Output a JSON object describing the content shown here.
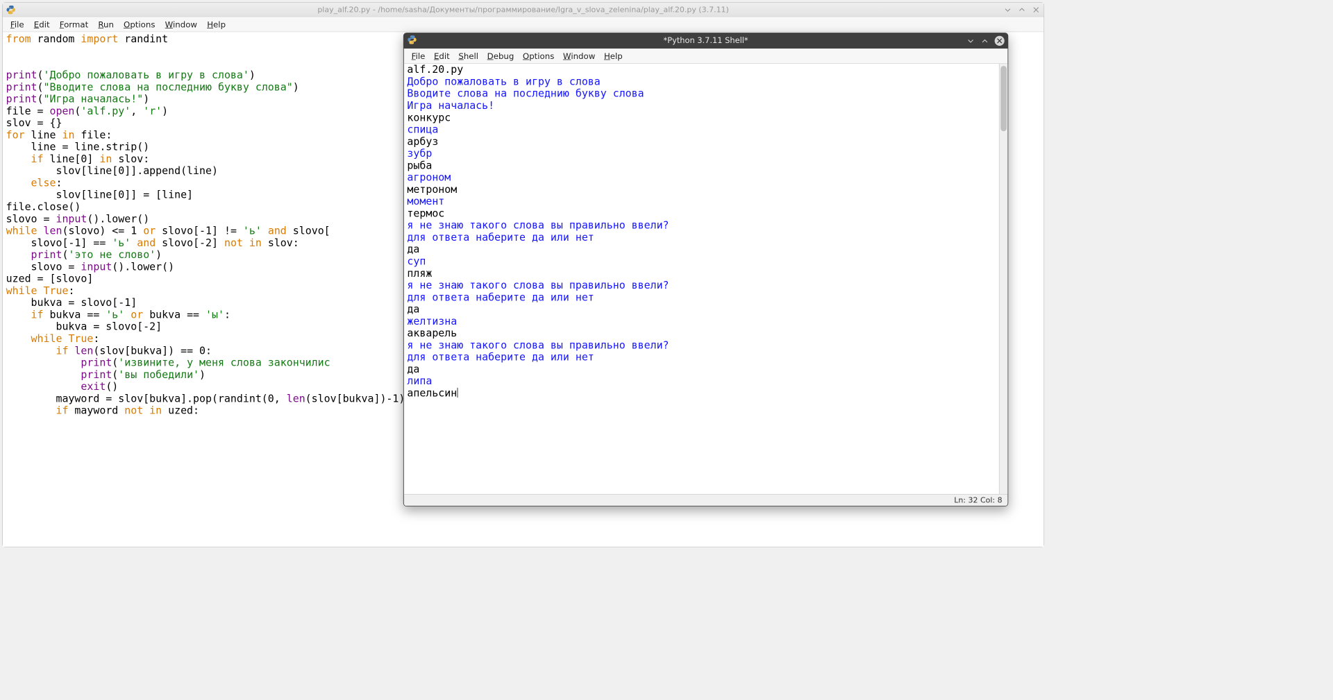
{
  "editor": {
    "title": "play_alf.20.py - /home/sasha/Документы/программирование/Igra_v_slova_zelenina/play_alf.20.py (3.7.11)",
    "menu": [
      "File",
      "Edit",
      "Format",
      "Run",
      "Options",
      "Window",
      "Help"
    ],
    "code_tokens": [
      [
        {
          "t": "from ",
          "c": "kw"
        },
        {
          "t": "random ",
          "c": ""
        },
        {
          "t": "import ",
          "c": "kw"
        },
        {
          "t": "randint",
          "c": ""
        }
      ],
      [],
      [],
      [
        {
          "t": "print",
          "c": "bi"
        },
        {
          "t": "(",
          "c": ""
        },
        {
          "t": "'Добро пожаловать в игру в слова'",
          "c": "str"
        },
        {
          "t": ")",
          "c": ""
        }
      ],
      [
        {
          "t": "print",
          "c": "bi"
        },
        {
          "t": "(",
          "c": ""
        },
        {
          "t": "\"Вводите слова на последнию букву слова\"",
          "c": "str"
        },
        {
          "t": ")",
          "c": ""
        }
      ],
      [
        {
          "t": "print",
          "c": "bi"
        },
        {
          "t": "(",
          "c": ""
        },
        {
          "t": "\"Игра началась!\"",
          "c": "str"
        },
        {
          "t": ")",
          "c": ""
        }
      ],
      [
        {
          "t": "file = ",
          "c": ""
        },
        {
          "t": "open",
          "c": "bi"
        },
        {
          "t": "(",
          "c": ""
        },
        {
          "t": "'alf.py'",
          "c": "str"
        },
        {
          "t": ", ",
          "c": ""
        },
        {
          "t": "'r'",
          "c": "str"
        },
        {
          "t": ")",
          "c": ""
        }
      ],
      [
        {
          "t": "slov = {}",
          "c": ""
        }
      ],
      [
        {
          "t": "for ",
          "c": "kw"
        },
        {
          "t": "line ",
          "c": ""
        },
        {
          "t": "in ",
          "c": "kw"
        },
        {
          "t": "file:",
          "c": ""
        }
      ],
      [
        {
          "t": "    line = line.strip()",
          "c": ""
        }
      ],
      [
        {
          "t": "    ",
          "c": ""
        },
        {
          "t": "if ",
          "c": "kw"
        },
        {
          "t": "line[",
          "c": ""
        },
        {
          "t": "0",
          "c": ""
        },
        {
          "t": "] ",
          "c": ""
        },
        {
          "t": "in ",
          "c": "kw"
        },
        {
          "t": "slov:",
          "c": ""
        }
      ],
      [
        {
          "t": "        slov[line[",
          "c": ""
        },
        {
          "t": "0",
          "c": ""
        },
        {
          "t": "]].append(line)",
          "c": ""
        }
      ],
      [
        {
          "t": "    ",
          "c": ""
        },
        {
          "t": "else",
          "c": "kw"
        },
        {
          "t": ":",
          "c": ""
        }
      ],
      [
        {
          "t": "        slov[line[",
          "c": ""
        },
        {
          "t": "0",
          "c": ""
        },
        {
          "t": "]] = [line]",
          "c": ""
        }
      ],
      [
        {
          "t": "file.close()",
          "c": ""
        }
      ],
      [
        {
          "t": "slovo = ",
          "c": ""
        },
        {
          "t": "input",
          "c": "bi"
        },
        {
          "t": "().lower()",
          "c": ""
        }
      ],
      [
        {
          "t": "while ",
          "c": "kw"
        },
        {
          "t": "len",
          "c": "bi"
        },
        {
          "t": "(slovo) <= ",
          "c": ""
        },
        {
          "t": "1 ",
          "c": ""
        },
        {
          "t": "or ",
          "c": "kw"
        },
        {
          "t": "slovo[-",
          "c": ""
        },
        {
          "t": "1",
          "c": ""
        },
        {
          "t": "] != ",
          "c": ""
        },
        {
          "t": "'ь' ",
          "c": "str"
        },
        {
          "t": "and ",
          "c": "kw"
        },
        {
          "t": "slovo[",
          "c": ""
        }
      ],
      [
        {
          "t": "    slovo[-",
          "c": ""
        },
        {
          "t": "1",
          "c": ""
        },
        {
          "t": "] == ",
          "c": ""
        },
        {
          "t": "'ь' ",
          "c": "str"
        },
        {
          "t": "and ",
          "c": "kw"
        },
        {
          "t": "slovo[-",
          "c": ""
        },
        {
          "t": "2",
          "c": ""
        },
        {
          "t": "] ",
          "c": ""
        },
        {
          "t": "not in ",
          "c": "kw"
        },
        {
          "t": "slov:",
          "c": ""
        }
      ],
      [
        {
          "t": "    ",
          "c": ""
        },
        {
          "t": "print",
          "c": "bi"
        },
        {
          "t": "(",
          "c": ""
        },
        {
          "t": "'это не слово'",
          "c": "str"
        },
        {
          "t": ")",
          "c": ""
        }
      ],
      [
        {
          "t": "    slovo = ",
          "c": ""
        },
        {
          "t": "input",
          "c": "bi"
        },
        {
          "t": "().lower()",
          "c": ""
        }
      ],
      [
        {
          "t": "uzed = [slovo]",
          "c": ""
        }
      ],
      [
        {
          "t": "while ",
          "c": "kw"
        },
        {
          "t": "True",
          "c": "kw"
        },
        {
          "t": ":",
          "c": ""
        }
      ],
      [
        {
          "t": "    bukva = slovo[-",
          "c": ""
        },
        {
          "t": "1",
          "c": ""
        },
        {
          "t": "]",
          "c": ""
        }
      ],
      [
        {
          "t": "    ",
          "c": ""
        },
        {
          "t": "if ",
          "c": "kw"
        },
        {
          "t": "bukva == ",
          "c": ""
        },
        {
          "t": "'ь' ",
          "c": "str"
        },
        {
          "t": "or ",
          "c": "kw"
        },
        {
          "t": "bukva == ",
          "c": ""
        },
        {
          "t": "'ы'",
          "c": "str"
        },
        {
          "t": ":",
          "c": ""
        }
      ],
      [
        {
          "t": "        bukva = slovo[-",
          "c": ""
        },
        {
          "t": "2",
          "c": ""
        },
        {
          "t": "]",
          "c": ""
        }
      ],
      [
        {
          "t": "    ",
          "c": ""
        },
        {
          "t": "while ",
          "c": "kw"
        },
        {
          "t": "True",
          "c": "kw"
        },
        {
          "t": ":",
          "c": ""
        }
      ],
      [
        {
          "t": "        ",
          "c": ""
        },
        {
          "t": "if ",
          "c": "kw"
        },
        {
          "t": "len",
          "c": "bi"
        },
        {
          "t": "(slov[bukva]) == ",
          "c": ""
        },
        {
          "t": "0",
          "c": ""
        },
        {
          "t": ":",
          "c": ""
        }
      ],
      [
        {
          "t": "            ",
          "c": ""
        },
        {
          "t": "print",
          "c": "bi"
        },
        {
          "t": "(",
          "c": ""
        },
        {
          "t": "'извините, у меня слова закончилис",
          "c": "str"
        }
      ],
      [
        {
          "t": "            ",
          "c": ""
        },
        {
          "t": "print",
          "c": "bi"
        },
        {
          "t": "(",
          "c": ""
        },
        {
          "t": "'вы победили'",
          "c": "str"
        },
        {
          "t": ")",
          "c": ""
        }
      ],
      [
        {
          "t": "            ",
          "c": ""
        },
        {
          "t": "exit",
          "c": "bi"
        },
        {
          "t": "()",
          "c": ""
        }
      ],
      [
        {
          "t": "        mayword = slov[bukva].pop(randint(",
          "c": ""
        },
        {
          "t": "0",
          "c": ""
        },
        {
          "t": ", ",
          "c": ""
        },
        {
          "t": "len",
          "c": "bi"
        },
        {
          "t": "(slov[bukva])-",
          "c": ""
        },
        {
          "t": "1",
          "c": ""
        },
        {
          "t": "))",
          "c": ""
        }
      ],
      [
        {
          "t": "        ",
          "c": ""
        },
        {
          "t": "if ",
          "c": "kw"
        },
        {
          "t": "mayword ",
          "c": ""
        },
        {
          "t": "not in ",
          "c": "kw"
        },
        {
          "t": "uzed:",
          "c": ""
        }
      ]
    ]
  },
  "shell": {
    "title": "*Python 3.7.11 Shell*",
    "menu": [
      "File",
      "Edit",
      "Shell",
      "Debug",
      "Options",
      "Window",
      "Help"
    ],
    "lines": [
      {
        "t": "alf.20.py",
        "c": "",
        "cut": true
      },
      {
        "t": "Добро пожаловать в игру в слова",
        "c": "out"
      },
      {
        "t": "Вводите слова на последнию букву слова",
        "c": "out"
      },
      {
        "t": "Игра началась!",
        "c": "out"
      },
      {
        "t": "конкурс",
        "c": ""
      },
      {
        "t": "спица",
        "c": "out"
      },
      {
        "t": "арбуз",
        "c": ""
      },
      {
        "t": "зубр",
        "c": "out"
      },
      {
        "t": "рыба",
        "c": ""
      },
      {
        "t": "агроном",
        "c": "out"
      },
      {
        "t": "метроном",
        "c": ""
      },
      {
        "t": "момент",
        "c": "out"
      },
      {
        "t": "термос",
        "c": ""
      },
      {
        "t": "я не знаю такого слова вы правильно ввели?",
        "c": "out"
      },
      {
        "t": "для ответа наберите да или нет",
        "c": "out"
      },
      {
        "t": "да",
        "c": ""
      },
      {
        "t": "суп",
        "c": "out"
      },
      {
        "t": "пляж",
        "c": ""
      },
      {
        "t": "я не знаю такого слова вы правильно ввели?",
        "c": "out"
      },
      {
        "t": "для ответа наберите да или нет",
        "c": "out"
      },
      {
        "t": "да",
        "c": ""
      },
      {
        "t": "желтизна",
        "c": "out"
      },
      {
        "t": "акварель",
        "c": ""
      },
      {
        "t": "я не знаю такого слова вы правильно ввели?",
        "c": "out"
      },
      {
        "t": "для ответа наберите да или нет",
        "c": "out"
      },
      {
        "t": "да",
        "c": ""
      },
      {
        "t": "липа",
        "c": "out"
      },
      {
        "t": "апельсин",
        "c": "",
        "cursor": true
      }
    ],
    "status": "Ln: 32  Col: 8"
  }
}
